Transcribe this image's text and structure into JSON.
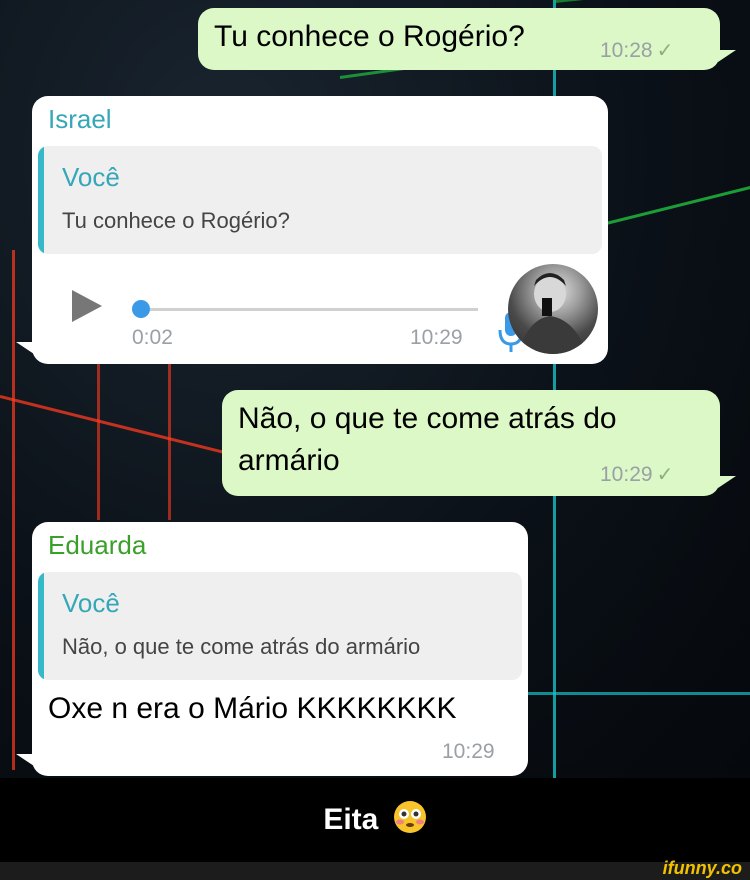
{
  "messages": {
    "m1": {
      "text": "Tu conhece o Rogério?",
      "time": "10:28",
      "status": "✓"
    },
    "m2": {
      "sender": "Israel",
      "quote_author": "Você",
      "quote_text": "Tu conhece o Rogério?",
      "audio_duration": "0:02",
      "time": "10:29"
    },
    "m3": {
      "text": "Não, o que te come atrás do armário",
      "time": "10:29",
      "status": "✓"
    },
    "m4": {
      "sender": "Eduarda",
      "quote_author": "Você",
      "quote_text": "Não, o que te come atrás do armário",
      "text": "Oxe n era o Mário KKKKKKKK",
      "time": "10:29"
    }
  },
  "audio_progress": 0.0,
  "caption": {
    "text": "Eita",
    "emoji": "😳"
  },
  "watermark": "ifunny.co",
  "colors": {
    "outgoing_bubble": "#dcf8c6",
    "incoming_bubble": "#ffffff",
    "israel_name": "#35a7b8",
    "eduarda_name": "#3aa02a",
    "quote_bar": "#35b8c7",
    "audio_dot": "#3b9ae8",
    "watermark": "#f2c200"
  },
  "icons": [
    "play-icon",
    "microphone-icon",
    "check-icon",
    "avatar"
  ]
}
